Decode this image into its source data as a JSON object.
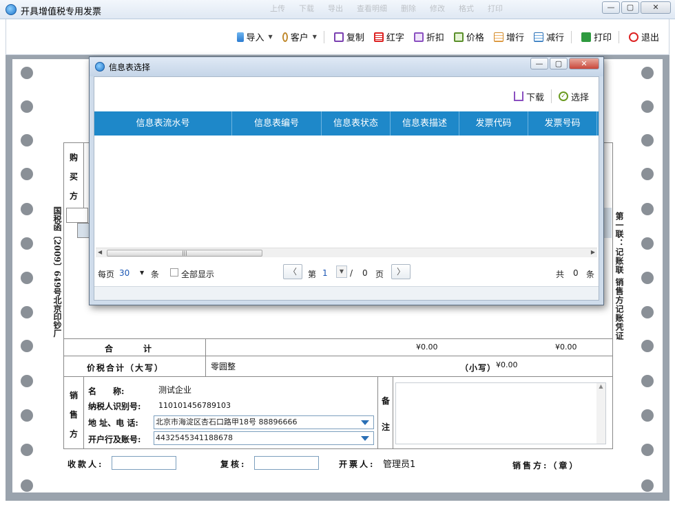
{
  "window": {
    "title": "开具增值税专用发票",
    "ghost_menu": [
      "上传",
      "下载",
      "导出",
      "查看明细",
      "删除",
      "修改",
      "格式",
      "打印"
    ]
  },
  "toolbar": {
    "import": "导入",
    "customer": "客户",
    "copy": "复制",
    "red": "红字",
    "discount": "折扣",
    "price": "价格",
    "add_row": "增行",
    "del_row": "减行",
    "print": "打印",
    "exit": "退出"
  },
  "invoice": {
    "left_vertical": "国税函〔2009〕649号北京印钞厂",
    "right_vertical": "第一联：记账联 销售方记账凭证",
    "buyer_label": [
      "购",
      "买",
      "方"
    ],
    "total_label": "合　　　计",
    "total_amount": "¥0.00",
    "total_tax": "¥0.00",
    "tax_total_label": "价税合计（大写）",
    "tax_total_upper": "零圆整",
    "tax_total_small_label": "（小写）",
    "tax_total_small": "¥0.00",
    "seller_label": [
      "销",
      "售",
      "方"
    ],
    "name_label": "名　　称:",
    "name_value": "测试企业",
    "taxid_label": "纳税人识别号:",
    "taxid_value": "110101456789103",
    "addr_label": "地 址、电 话:",
    "addr_value": "北京市海淀区杏石口路甲18号 88896666",
    "bank_label": "开户行及账号:",
    "bank_value": "4432545341188678",
    "remark_label": [
      "备",
      "注"
    ],
    "payee_label": "收款人:",
    "reviewer_label": "复核:",
    "drawer_label": "开票人:",
    "drawer_value": "管理员1",
    "seller_seal_label": "销售方:（章）"
  },
  "dialog": {
    "title": "信息表选择",
    "download": "下载",
    "select": "选择",
    "columns": [
      "信息表流水号",
      "信息表编号",
      "信息表状态",
      "信息表描述",
      "发票代码",
      "发票号码"
    ],
    "per_page_label": "每页",
    "per_page_value": "30",
    "per_page_unit": "条",
    "show_all": "全部显示",
    "page_label": "第",
    "page_current": "1",
    "page_sep": "/",
    "page_total": "0",
    "page_unit": "页",
    "total_label": "共",
    "total_count": "0",
    "total_unit": "条"
  }
}
